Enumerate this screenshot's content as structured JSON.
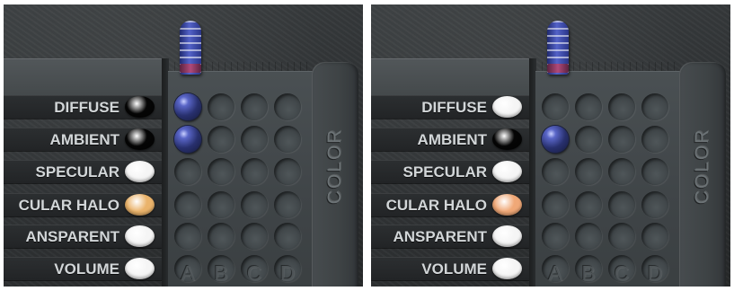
{
  "panels": [
    {
      "labels": [
        {
          "text": "DIFFUSE",
          "swatch": "#050505"
        },
        {
          "text": "AMBIENT",
          "swatch": "#050505"
        },
        {
          "text": "SPECULAR",
          "swatch": "#f5f5f5"
        },
        {
          "text": "CULAR HALO",
          "swatch": "#eab36b"
        },
        {
          "text": "ANSPARENT",
          "swatch": "#f5f5f5"
        },
        {
          "text": "VOLUME",
          "swatch": "#f5f5f5"
        }
      ],
      "active_sockets": [
        [
          0,
          0
        ],
        [
          1,
          0
        ]
      ],
      "column_letters": [
        "A",
        "B",
        "C",
        "D"
      ],
      "color_label": "COLOR"
    },
    {
      "labels": [
        {
          "text": "DIFFUSE",
          "swatch": "#f5f5f5"
        },
        {
          "text": "AMBIENT",
          "swatch": "#050505"
        },
        {
          "text": "SPECULAR",
          "swatch": "#f5f5f5"
        },
        {
          "text": "CULAR HALO",
          "swatch": "#f0a877"
        },
        {
          "text": "ANSPARENT",
          "swatch": "#f5f5f5"
        },
        {
          "text": "VOLUME",
          "swatch": "#f5f5f5"
        }
      ],
      "active_sockets": [
        [
          1,
          0
        ]
      ],
      "column_letters": [
        "A",
        "B",
        "C",
        "D"
      ],
      "color_label": "COLOR"
    }
  ],
  "icons": {
    "knob": "slider-knob-icon",
    "socket": "socket-icon",
    "swatch": "color-swatch-icon"
  }
}
